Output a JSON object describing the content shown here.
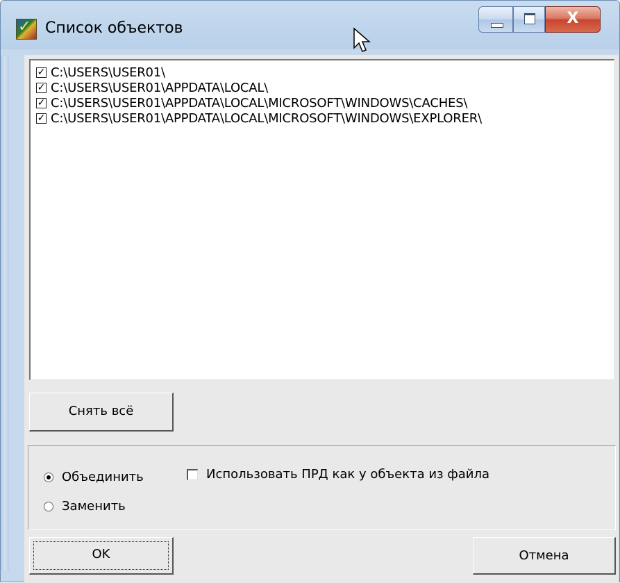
{
  "window": {
    "title": "Список объектов",
    "close_glyph": "X"
  },
  "list": {
    "items": [
      {
        "label": "C:\\USERS\\USER01\\",
        "checked": true
      },
      {
        "label": "C:\\USERS\\USER01\\APPDATA\\LOCAL\\",
        "checked": true
      },
      {
        "label": "C:\\USERS\\USER01\\APPDATA\\LOCAL\\MICROSOFT\\WINDOWS\\CACHES\\",
        "checked": true
      },
      {
        "label": "C:\\USERS\\USER01\\APPDATA\\LOCAL\\MICROSOFT\\WINDOWS\\EXPLORER\\",
        "checked": true
      }
    ],
    "check_glyph": "✓"
  },
  "buttons": {
    "clear_all": "Снять всё",
    "ok": "OK",
    "cancel": "Отмена"
  },
  "options": {
    "merge": {
      "label": "Объединить",
      "selected": true
    },
    "replace": {
      "label": "Заменить",
      "selected": false
    },
    "use_prd": {
      "label": "Использовать ПРД как у объекта из файла",
      "checked": false
    }
  },
  "icons": {
    "app": "app-icon",
    "minimize": "minimize-icon",
    "maximize": "maximize-icon",
    "close": "close-icon",
    "cursor": "mouse-cursor-icon"
  }
}
